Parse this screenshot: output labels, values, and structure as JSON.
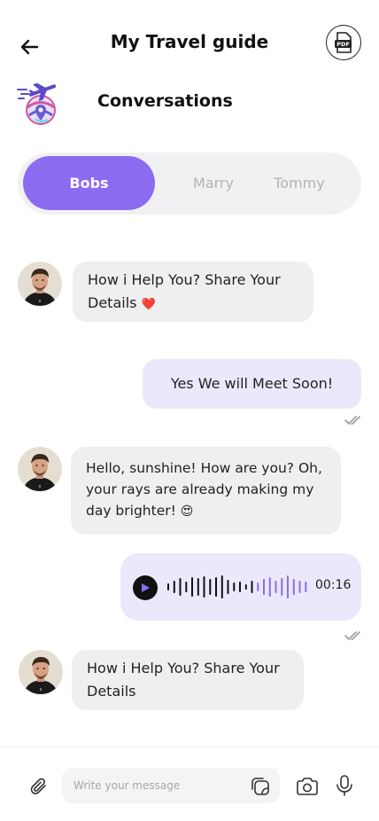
{
  "header": {
    "title": "My Travel guide",
    "pdf_label": "PDF"
  },
  "conversations": {
    "title": "Conversations"
  },
  "tabs": [
    {
      "label": "Bobs",
      "active": true
    },
    {
      "label": "Marry",
      "active": false
    },
    {
      "label": "Tommy",
      "active": false
    }
  ],
  "messages": [
    {
      "from": "other",
      "line1": "How i Help You? Share Your",
      "line2": "Details",
      "emoji": "❤️"
    },
    {
      "from": "me",
      "text": "Yes We will Meet Soon!",
      "status": "read"
    },
    {
      "from": "other",
      "line1": "Hello, sunshine! How are you? Oh,",
      "line2": "your rays are already making my",
      "line3": "day brighter!",
      "emoji": "😍"
    },
    {
      "from": "me",
      "type": "voice",
      "duration": "00:16",
      "played_fraction": 0.6,
      "status": "read"
    },
    {
      "from": "other",
      "line1": "How i Help You? Share Your",
      "line2": "Details"
    }
  ],
  "composer": {
    "placeholder": "Write your message"
  },
  "icons": {
    "back": "arrow-left-icon",
    "pdf": "pdf-icon",
    "attach": "paperclip-icon",
    "sticker": "sticker-icon",
    "camera": "camera-icon",
    "mic": "microphone-icon",
    "play": "play-icon",
    "read": "double-check-icon"
  },
  "colors": {
    "accent": "#8b6cf0",
    "my_bubble": "#ebe8fb",
    "their_bubble": "#efefef",
    "tabs_bg": "#f1f1f3"
  }
}
